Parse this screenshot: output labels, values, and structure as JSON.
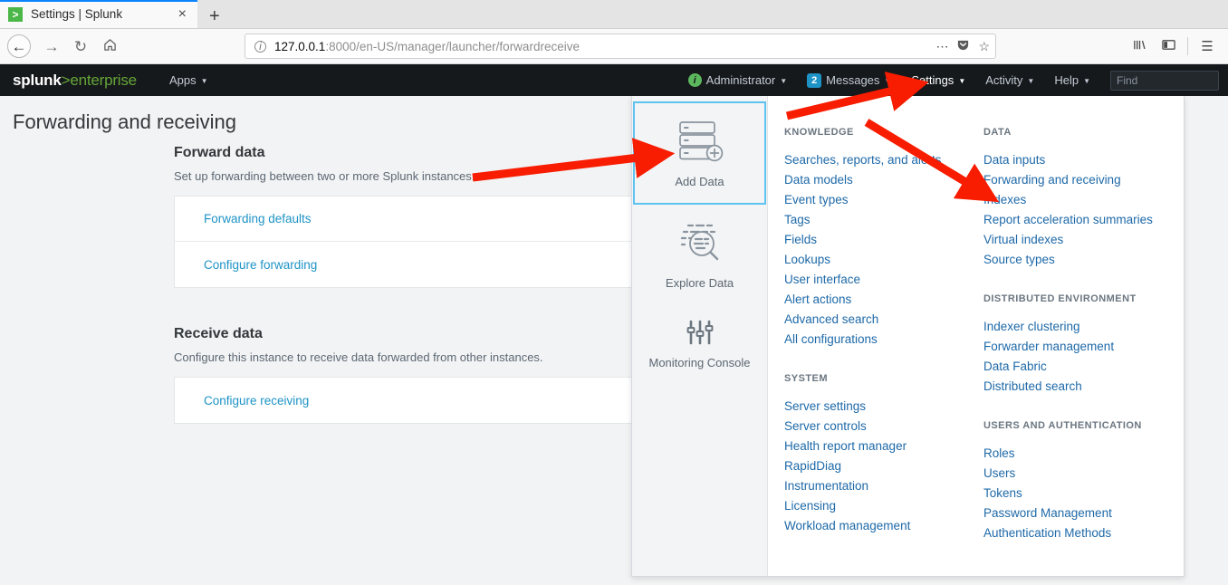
{
  "browser": {
    "tab": {
      "title": "Settings | Splunk",
      "favicon": "splunk-favicon",
      "close_label": "×"
    },
    "new_tab_label": "+",
    "nav": {
      "back": "←",
      "forward": "→",
      "reload": "↻",
      "home": "⌂"
    },
    "url": {
      "host": "127.0.0.1",
      "rest": ":8000/en-US/manager/launcher/forwardreceive"
    },
    "urlbar_actions": {
      "ellipsis": "⋯",
      "pocket": "pocket-icon",
      "bookmark": "☆"
    },
    "toolbar_right": {
      "library": "library-icon",
      "sidebar": "sidebar-icon",
      "menu": "☰"
    }
  },
  "header": {
    "logo": {
      "part1": "splunk",
      "part2": ">",
      "part3": "enterprise"
    },
    "apps": "Apps",
    "administrator": "Administrator",
    "messages": "Messages",
    "messages_count": "2",
    "settings": "Settings",
    "activity": "Activity",
    "help": "Help",
    "find_placeholder": "Find",
    "caret": "▼",
    "accent_green": "#65a637",
    "accent_blue": "#1e93c6"
  },
  "page": {
    "title": "Forwarding and receiving",
    "sections": [
      {
        "heading": "Forward data",
        "description": "Set up forwarding between two or more Splunk instances.",
        "links": [
          "Forwarding defaults",
          "Configure forwarding"
        ]
      },
      {
        "heading": "Receive data",
        "description": "Configure this instance to receive data forwarded from other instances.",
        "links": [
          "Configure receiving"
        ]
      }
    ]
  },
  "settings_menu": {
    "tiles": [
      {
        "label": "Add Data",
        "icon": "add-data-icon",
        "selected": true
      },
      {
        "label": "Explore Data",
        "icon": "explore-data-icon",
        "selected": false
      },
      {
        "label": "Monitoring Console",
        "icon": "monitoring-console-icon",
        "selected": false
      }
    ],
    "columns": [
      {
        "groups": [
          {
            "heading": "KNOWLEDGE",
            "items": [
              "Searches, reports, and alerts",
              "Data models",
              "Event types",
              "Tags",
              "Fields",
              "Lookups",
              "User interface",
              "Alert actions",
              "Advanced search",
              "All configurations"
            ]
          },
          {
            "heading": "SYSTEM",
            "items": [
              "Server settings",
              "Server controls",
              "Health report manager",
              "RapidDiag",
              "Instrumentation",
              "Licensing",
              "Workload management"
            ]
          }
        ]
      },
      {
        "groups": [
          {
            "heading": "DATA",
            "items": [
              "Data inputs",
              "Forwarding and receiving",
              "Indexes",
              "Report acceleration summaries",
              "Virtual indexes",
              "Source types"
            ]
          },
          {
            "heading": "DISTRIBUTED ENVIRONMENT",
            "items": [
              "Indexer clustering",
              "Forwarder management",
              "Data Fabric",
              "Distributed search"
            ]
          },
          {
            "heading": "USERS AND AUTHENTICATION",
            "items": [
              "Roles",
              "Users",
              "Tokens",
              "Password Management",
              "Authentication Methods"
            ]
          }
        ]
      }
    ]
  },
  "annotations": {
    "arrow_color": "#f81c00",
    "arrows": [
      {
        "name": "arrow-to-add-data",
        "target": "Add Data"
      },
      {
        "name": "arrow-settings-to-forwarding",
        "target": "Forwarding and receiving"
      }
    ]
  }
}
